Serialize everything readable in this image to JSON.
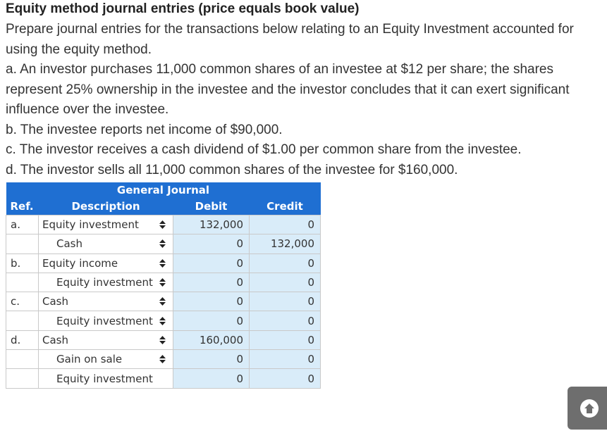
{
  "title": "Equity method journal entries (price equals book value)",
  "intro": "Prepare journal entries for the transactions below relating to an Equity Investment accounted for using the equity method.",
  "transactions": {
    "a": "a. An investor purchases 11,000 common shares of an investee at $12 per share; the shares represent 25% ownership in the investee and the investor concludes that it can exert significant influence over the investee.",
    "b": "b. The investee reports net income of $90,000.",
    "c": "c. The investor receives a cash dividend of $1.00 per common share from the investee.",
    "d": "d. The investor sells all 11,000 common shares of the investee for $160,000."
  },
  "journal": {
    "title": "General Journal",
    "headers": {
      "ref": "Ref.",
      "description": "Description",
      "debit": "Debit",
      "credit": "Credit"
    },
    "rows": [
      {
        "ref": "a.",
        "description": "Equity investment",
        "indent": false,
        "debit": "132,000",
        "credit": "0",
        "has_select": true
      },
      {
        "ref": "",
        "description": "Cash",
        "indent": true,
        "debit": "0",
        "credit": "132,000",
        "has_select": true
      },
      {
        "ref": "b.",
        "description": "Equity income",
        "indent": false,
        "debit": "0",
        "credit": "0",
        "has_select": true
      },
      {
        "ref": "",
        "description": "Equity investment",
        "indent": true,
        "debit": "0",
        "credit": "0",
        "has_select": true
      },
      {
        "ref": "c.",
        "description": "Cash",
        "indent": false,
        "debit": "0",
        "credit": "0",
        "has_select": true
      },
      {
        "ref": "",
        "description": "Equity investment",
        "indent": true,
        "debit": "0",
        "credit": "0",
        "has_select": true
      },
      {
        "ref": "d.",
        "description": "Cash",
        "indent": false,
        "debit": "160,000",
        "credit": "0",
        "has_select": true
      },
      {
        "ref": "",
        "description": "Gain on sale",
        "indent": true,
        "debit": "0",
        "credit": "0",
        "has_select": true
      },
      {
        "ref": "",
        "description": "Equity investment",
        "indent": true,
        "debit": "0",
        "credit": "0",
        "has_select": false
      }
    ]
  },
  "icons": {
    "select_arrows": "select-arrows-icon",
    "scroll_top": "arrow-up-circle-icon"
  },
  "colors": {
    "header_bg": "#1f6fd2",
    "input_bg": "#d9ecf9"
  }
}
